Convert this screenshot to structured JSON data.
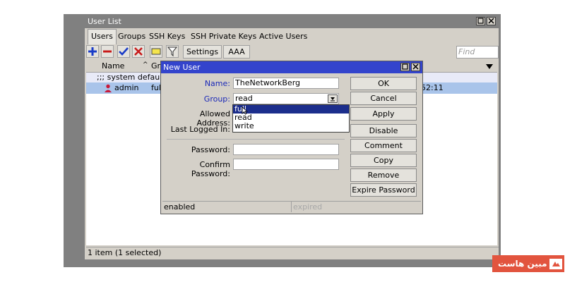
{
  "window": {
    "title": "User List"
  },
  "tabs": [
    "Users",
    "Groups",
    "SSH Keys",
    "SSH Private Keys",
    "Active Users"
  ],
  "toolbar": {
    "settings_label": "Settings",
    "aaa_label": "AAA",
    "find_placeholder": "Find"
  },
  "list": {
    "headers": {
      "name": "Name",
      "group": "Gr"
    },
    "comment_row": ";;; system default u",
    "user_row": {
      "name": "admin",
      "group": "ful",
      "last": "52:11"
    }
  },
  "status_text": "1 item (1 selected)",
  "dialog": {
    "title": "New User",
    "labels": {
      "name": "Name:",
      "group": "Group:",
      "allowed_address": "Allowed Address:",
      "last_logged_in": "Last Logged In:",
      "password": "Password:",
      "confirm_password": "Confirm Password:"
    },
    "values": {
      "name": "TheNetworkBerg",
      "group": "read",
      "password": "",
      "confirm_password": ""
    },
    "group_options": [
      "full",
      "read",
      "write"
    ],
    "buttons": [
      "OK",
      "Cancel",
      "Apply",
      "Disable",
      "Comment",
      "Copy",
      "Remove",
      "Expire Password"
    ],
    "status_left": "enabled",
    "status_right": "expired"
  },
  "watermark": {
    "text": "مبین هاست"
  },
  "colors": {
    "dialog_title_bg": "#3344cc",
    "selection_bg": "#1c2e8c",
    "brand_bg": "#e2543e"
  }
}
